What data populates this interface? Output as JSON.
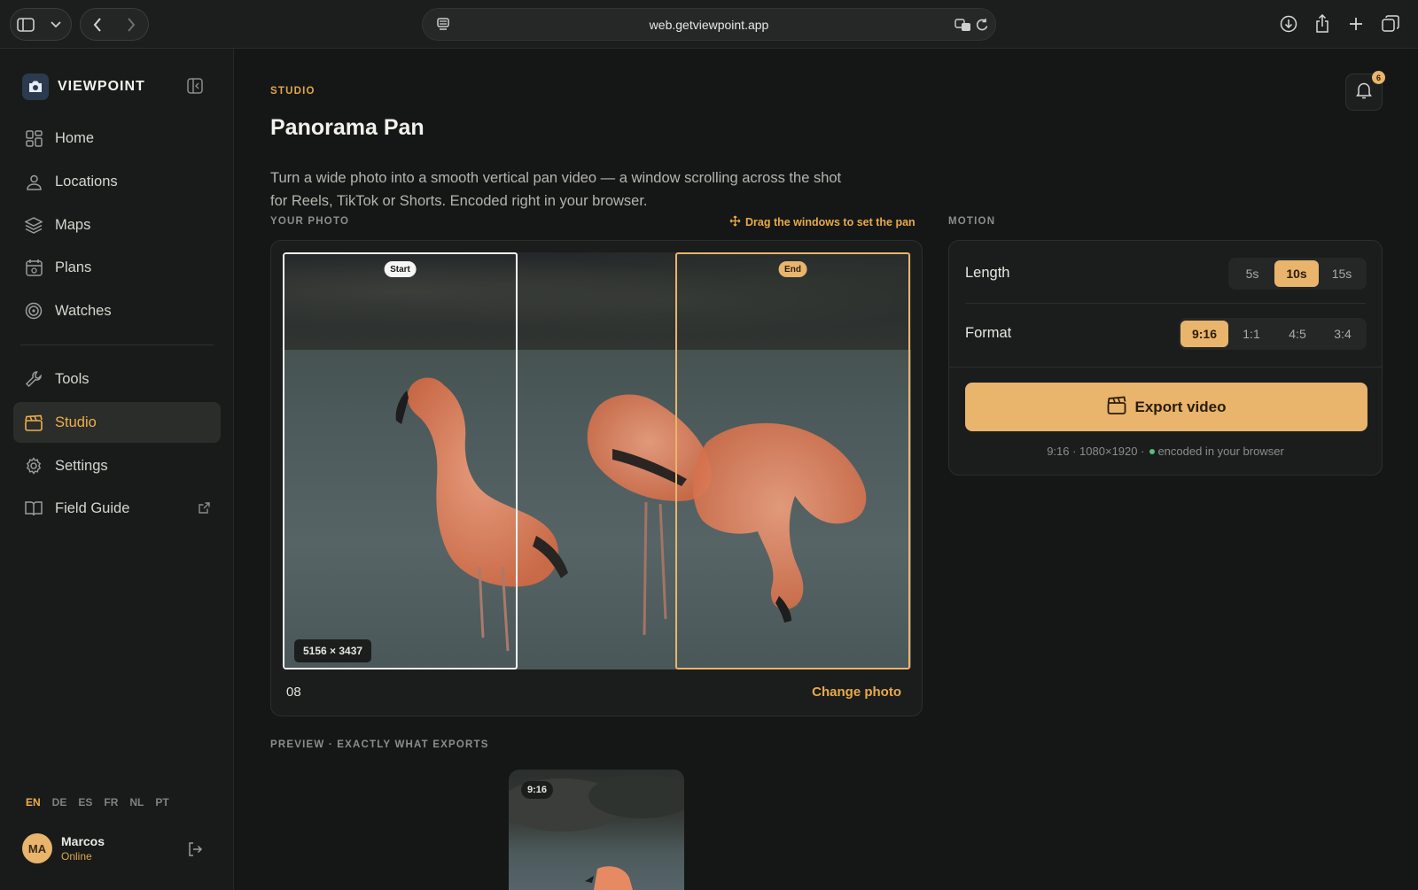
{
  "browser": {
    "url": "web.getviewpoint.app"
  },
  "sidebar": {
    "brand": "VIEWPOINT",
    "items": [
      {
        "label": "Home",
        "icon": "grid-icon"
      },
      {
        "label": "Locations",
        "icon": "location-icon"
      },
      {
        "label": "Maps",
        "icon": "layers-icon"
      },
      {
        "label": "Plans",
        "icon": "calendar-icon"
      },
      {
        "label": "Watches",
        "icon": "watch-icon"
      },
      {
        "label": "Tools",
        "icon": "wrench-icon"
      },
      {
        "label": "Studio",
        "icon": "clapper-icon",
        "active": true
      },
      {
        "label": "Settings",
        "icon": "gear-icon"
      },
      {
        "label": "Field Guide",
        "icon": "book-icon"
      }
    ],
    "languages": [
      "EN",
      "DE",
      "ES",
      "FR",
      "NL",
      "PT"
    ],
    "active_language": "EN",
    "user": {
      "initials": "MA",
      "name": "Marcos",
      "status": "Online"
    }
  },
  "header": {
    "eyebrow": "STUDIO",
    "title": "Panorama Pan",
    "description": "Turn a wide photo into a smooth vertical pan video — a window scrolling across the shot for Reels, TikTok or Shorts. Encoded right in your browser.",
    "notification_count": "6"
  },
  "photo": {
    "section_label": "YOUR PHOTO",
    "hint": "Drag the windows to set the pan",
    "start_label": "Start",
    "end_label": "End",
    "dimensions": "5156 × 3437",
    "filename": "08",
    "change_label": "Change photo"
  },
  "motion": {
    "section_label": "MOTION",
    "length_label": "Length",
    "length_options": [
      "5s",
      "10s",
      "15s"
    ],
    "length_selected": "10s",
    "format_label": "Format",
    "format_options": [
      "9:16",
      "1:1",
      "4:5",
      "3:4"
    ],
    "format_selected": "9:16",
    "export_label": "Export video",
    "meta_left": "9:16 · 1080×1920 ·",
    "meta_right": "encoded in your browser"
  },
  "preview": {
    "section_label": "PREVIEW · EXACTLY WHAT EXPORTS",
    "tag": "9:16"
  },
  "colors": {
    "accent": "#e9b46c",
    "background": "#141716",
    "sidebar": "#181b1a"
  }
}
